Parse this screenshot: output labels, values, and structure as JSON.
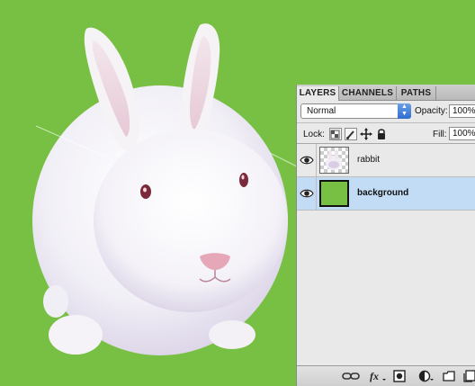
{
  "document": {
    "background_color": "#78c043"
  },
  "layers_panel": {
    "tabs": [
      {
        "label": "LAYERS",
        "active": true
      },
      {
        "label": "CHANNELS",
        "active": false
      },
      {
        "label": "PATHS",
        "active": false
      }
    ],
    "blend_mode": "Normal",
    "opacity_label": "Opacity:",
    "opacity_value": "100%",
    "lock_label": "Lock:",
    "fill_label": "Fill:",
    "fill_value": "100%",
    "layers": [
      {
        "name": "rabbit",
        "visible": true,
        "selected": false,
        "thumbnail": "transparent-checker-with-rabbit"
      },
      {
        "name": "background",
        "visible": true,
        "selected": true,
        "thumbnail": "solid-green"
      }
    ],
    "lock_icons": [
      "lock-transparent-pixels-icon",
      "lock-image-pixels-icon",
      "lock-position-icon",
      "lock-all-icon"
    ],
    "footer_icons": [
      "link-layers-icon",
      "layer-style-fx-icon",
      "layer-mask-icon",
      "adjustment-layer-icon",
      "new-group-icon",
      "new-layer-icon"
    ],
    "colors": {
      "selected_row": "#c3dcf6",
      "panel_bg": "#e9e9e9",
      "dropdown_accent": "#2f6cd0"
    }
  }
}
